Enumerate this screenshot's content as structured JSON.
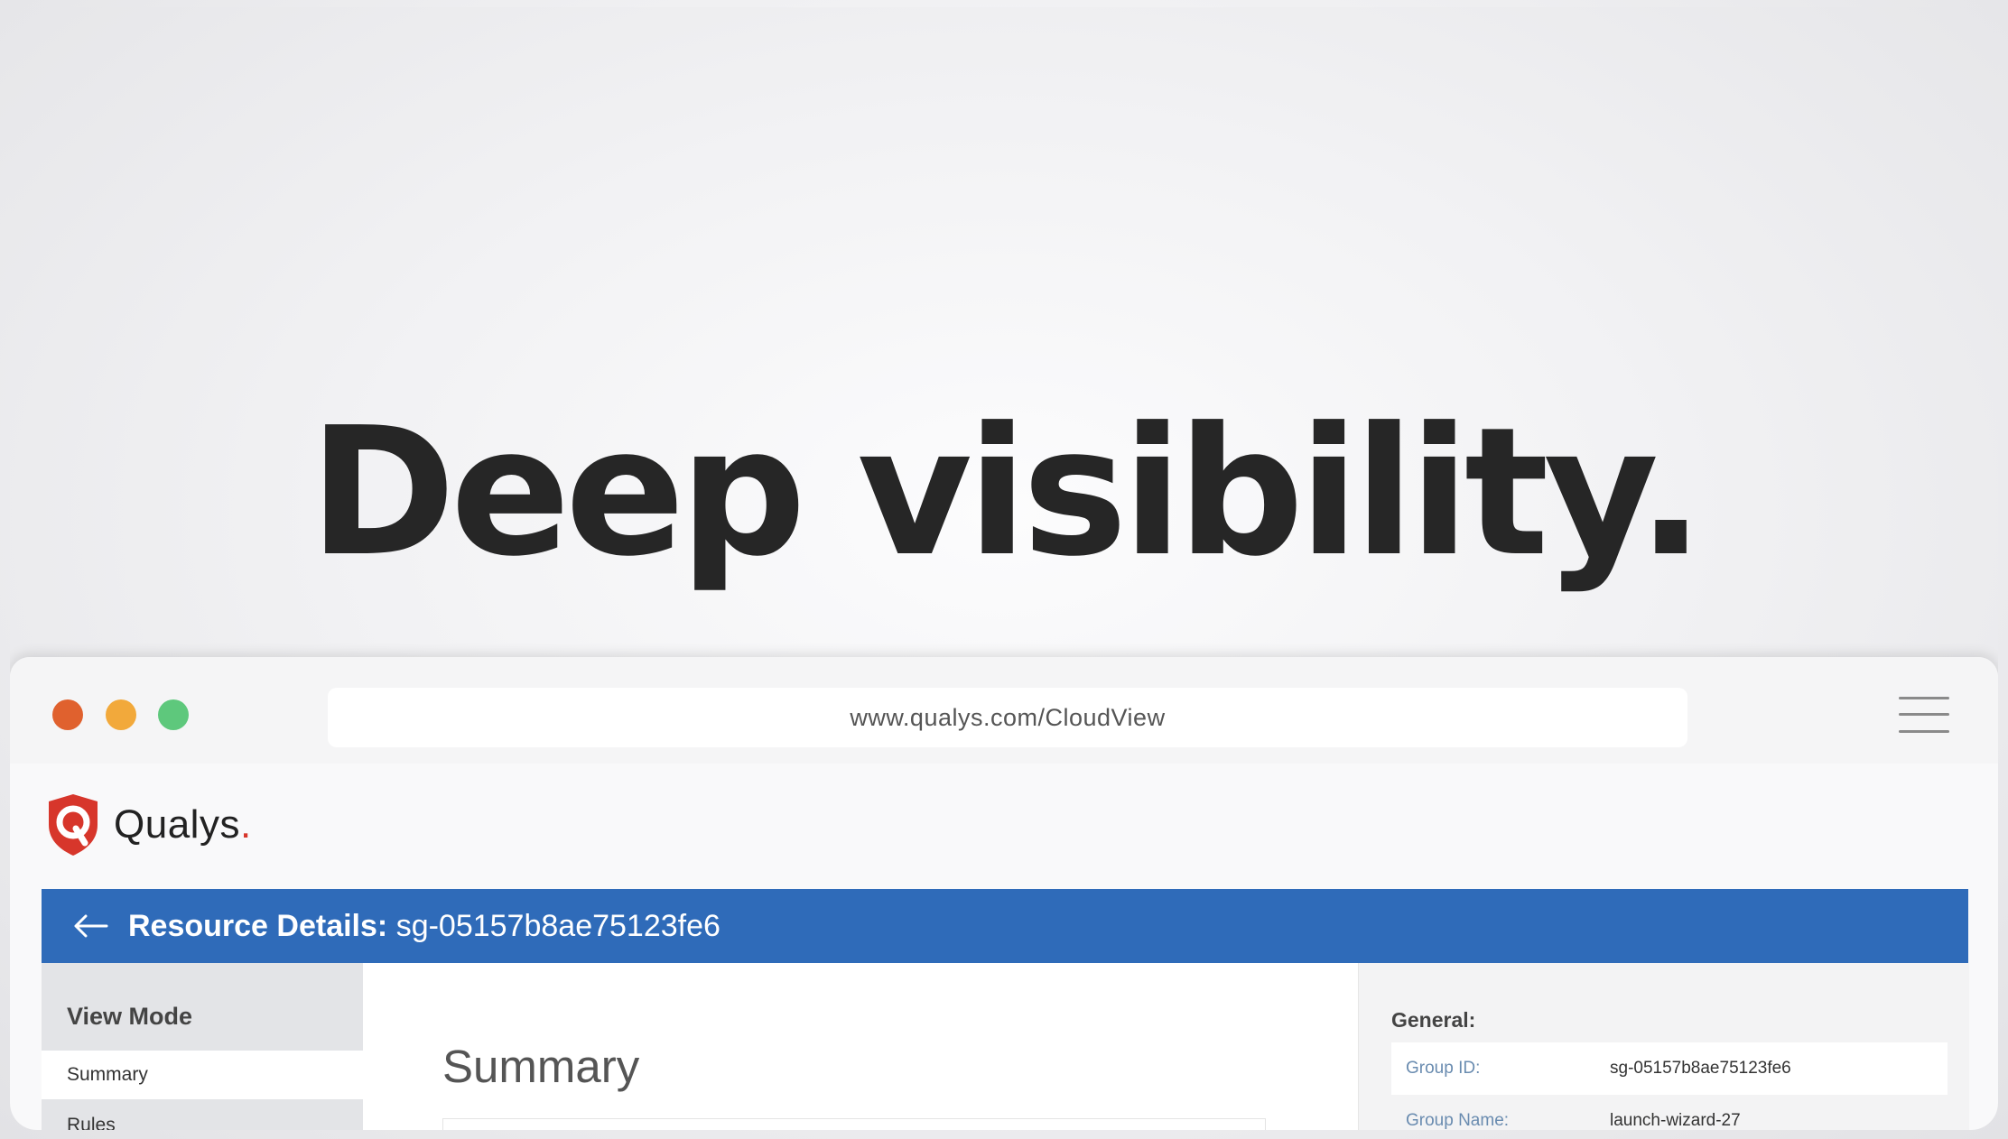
{
  "hero": {
    "headline": "Deep visibility."
  },
  "browser": {
    "url": "www.qualys.com/CloudView",
    "window_controls": [
      "close",
      "minimize",
      "maximize"
    ],
    "menu_icon": "hamburger-menu-icon"
  },
  "app": {
    "logo_text": "Qualys",
    "logo_dot": ".",
    "brand_color": "#d7362b",
    "accent_color": "#2f6bb9"
  },
  "header": {
    "title_label": "Resource Details:",
    "resource_id": "sg-05157b8ae75123fe6",
    "back_icon": "back-arrow-icon"
  },
  "sidebar": {
    "heading": "View Mode",
    "items": [
      {
        "label": "Summary",
        "active": true
      },
      {
        "label": "Rules",
        "active": false
      }
    ]
  },
  "main": {
    "title": "Summary"
  },
  "details": {
    "section": "General:",
    "fields": [
      {
        "label": "Group ID:",
        "value": "sg-05157b8ae75123fe6"
      },
      {
        "label": "Group Name:",
        "value": "launch-wizard-27"
      }
    ]
  }
}
